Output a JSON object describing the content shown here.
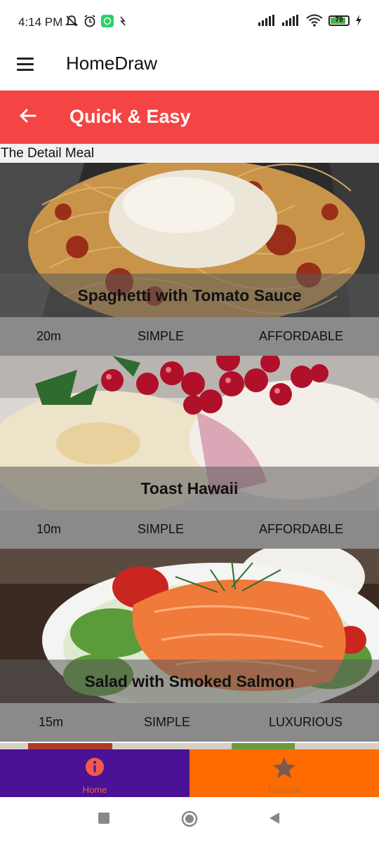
{
  "status_bar": {
    "time": "4:14 PM",
    "battery_level": "79"
  },
  "app_bar": {
    "title": "HomeDraw",
    "menu_icon": "hamburger-icon"
  },
  "screen_header": {
    "title": "Quick & Easy",
    "back_icon": "arrow-left-icon",
    "color": "#F44444"
  },
  "section_label": "The Detail Meal",
  "meals": [
    {
      "title": "Spaghetti with Tomato Sauce",
      "duration": "20m",
      "complexity": "SIMPLE",
      "affordability": "AFFORDABLE"
    },
    {
      "title": "Toast Hawaii",
      "duration": "10m",
      "complexity": "SIMPLE",
      "affordability": "AFFORDABLE"
    },
    {
      "title": "Salad with Smoked Salmon",
      "duration": "15m",
      "complexity": "SIMPLE",
      "affordability": "LUXURIOUS"
    }
  ],
  "bottom_nav": {
    "home_label": "Home",
    "favorite_label": "Favorite",
    "home_color": "#4A1296",
    "favorite_color": "#FF6B00"
  }
}
